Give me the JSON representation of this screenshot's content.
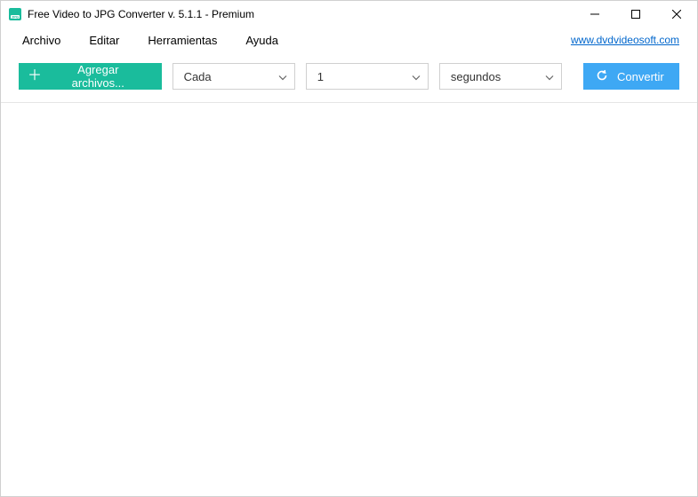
{
  "window": {
    "title": "Free Video to JPG Converter v. 5.1.1 - Premium"
  },
  "menu": {
    "archivo": "Archivo",
    "editar": "Editar",
    "herramientas": "Herramientas",
    "ayuda": "Ayuda",
    "site_link": "www.dvdvideosoft.com"
  },
  "toolbar": {
    "add_files": "Agregar archivos...",
    "every_selected": "Cada",
    "count_selected": "1",
    "unit_selected": "segundos",
    "convert": "Convertir"
  },
  "colors": {
    "add_button": "#1abc9c",
    "convert_button": "#3ea8f4",
    "link": "#0066cc"
  }
}
